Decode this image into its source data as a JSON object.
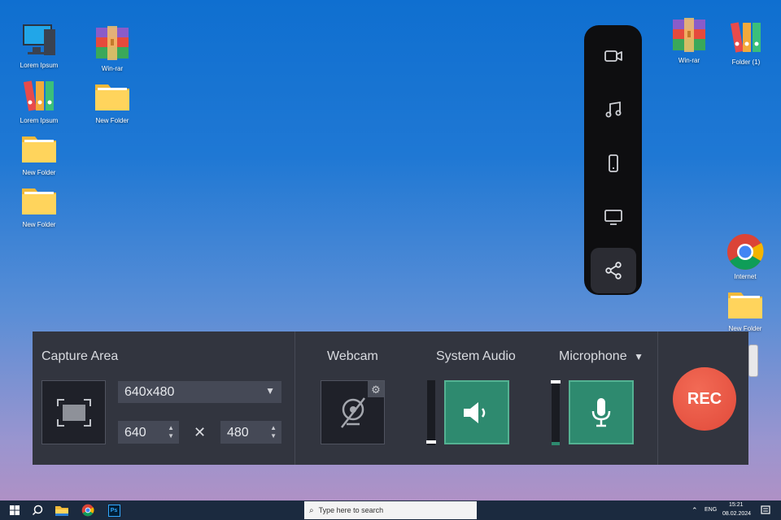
{
  "desktop": {
    "icons": [
      {
        "label": "Lorem Ipsum",
        "icon": "computer-icon"
      },
      {
        "label": "Win-rar",
        "icon": "winrar-icon"
      },
      {
        "label": "Lorem Ipsum",
        "icon": "binders-icon"
      },
      {
        "label": "New Folder",
        "icon": "folder-icon"
      },
      {
        "label": "New Folder",
        "icon": "folder-icon"
      },
      {
        "label": "New Folder",
        "icon": "folder-icon"
      },
      {
        "label": "Win-rar",
        "icon": "winrar-icon"
      },
      {
        "label": "Folder (1)",
        "icon": "binders-icon"
      },
      {
        "label": "Internet",
        "icon": "chrome-icon"
      },
      {
        "label": "New Folder",
        "icon": "folder-icon"
      }
    ]
  },
  "sidebar": {
    "items": [
      {
        "icon": "video-camera-icon",
        "active": false
      },
      {
        "icon": "music-note-icon",
        "active": false
      },
      {
        "icon": "phone-icon",
        "active": false
      },
      {
        "icon": "monitor-icon",
        "active": false
      },
      {
        "icon": "share-icon",
        "active": true
      }
    ]
  },
  "recorder": {
    "capture_area": {
      "title": "Capture Area",
      "preset": "640x480",
      "width": "640",
      "height": "480",
      "times": "✕"
    },
    "webcam": {
      "title": "Webcam"
    },
    "system_audio": {
      "title": "System Audio",
      "level": 0.0
    },
    "microphone": {
      "title": "Microphone",
      "level": 1.0
    },
    "rec_label": "REC"
  },
  "taskbar": {
    "search_placeholder": "Type here to search",
    "language": "ENG",
    "time": "15:21",
    "date": "08.02.2024"
  },
  "colors": {
    "accent_green": "#2e8a6f",
    "rec_red": "#e14a3a",
    "panel_bg": "#32353f"
  }
}
